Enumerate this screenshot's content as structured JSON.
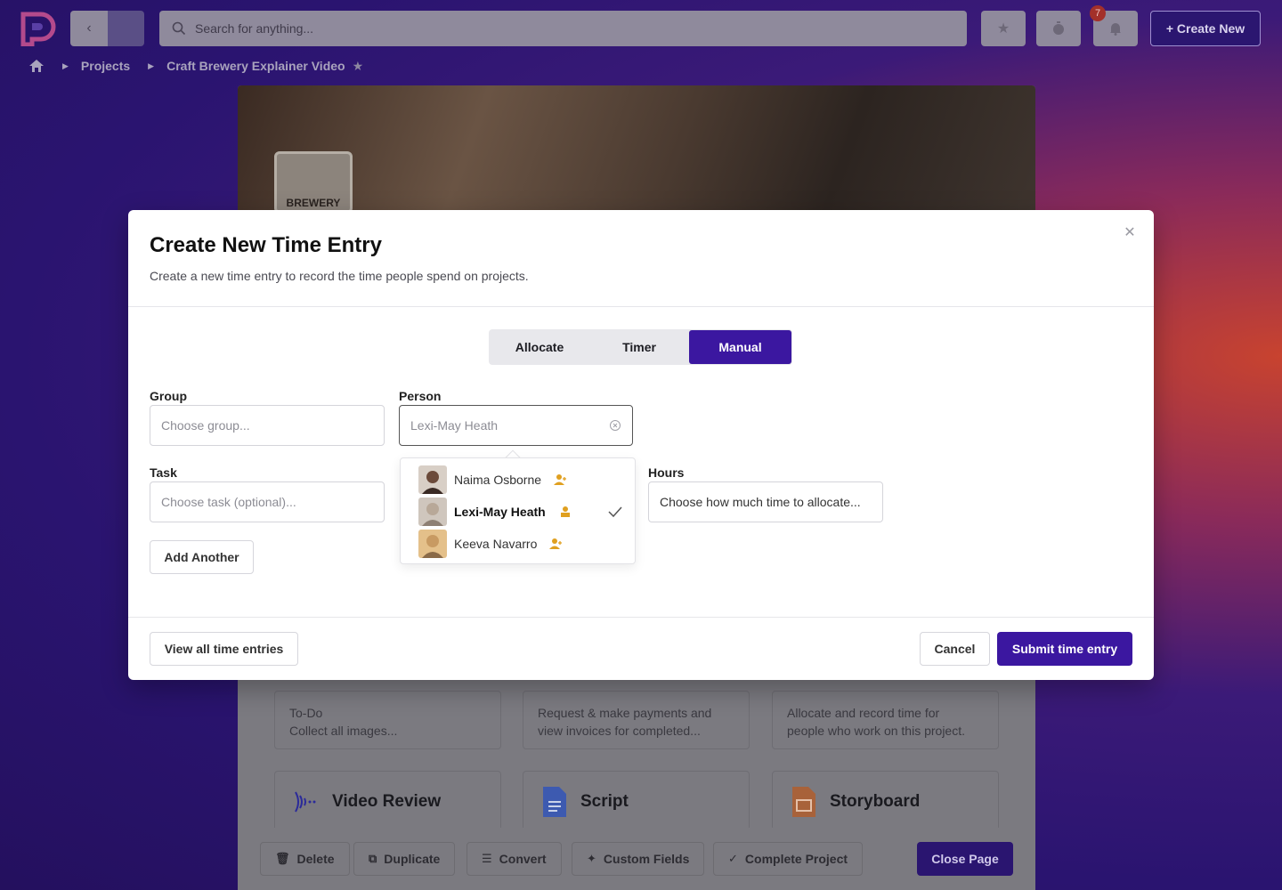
{
  "topbar": {
    "search_placeholder": "Search for anything...",
    "notification_count": "7",
    "create_new_label": "+ Create New"
  },
  "breadcrumb": {
    "projects": "Projects",
    "current": "Craft Brewery Explainer Video"
  },
  "background": {
    "hero_logo_text": "BREWERY",
    "tiles": [
      {
        "line1": "To-Do",
        "line2": "Collect all images..."
      },
      {
        "line1": "Request & make payments and",
        "line2": "view invoices for completed..."
      },
      {
        "line1": "Allocate and record time for",
        "line2": "people who work on this project."
      }
    ],
    "apps": [
      {
        "label": "Video Review",
        "icon": "waveform-icon"
      },
      {
        "label": "Script",
        "icon": "document-icon"
      },
      {
        "label": "Storyboard",
        "icon": "slides-icon"
      }
    ],
    "bottom_actions": {
      "delete": "Delete",
      "duplicate": "Duplicate",
      "convert": "Convert",
      "custom_fields": "Custom Fields",
      "complete_project": "Complete Project",
      "close_page": "Close Page"
    }
  },
  "modal": {
    "title": "Create New Time Entry",
    "subtitle": "Create a new time entry to record the time people spend on projects.",
    "tabs": [
      {
        "label": "Allocate",
        "active": false
      },
      {
        "label": "Timer",
        "active": false
      },
      {
        "label": "Manual",
        "active": true
      }
    ],
    "group": {
      "label": "Group",
      "placeholder": "Choose group..."
    },
    "person": {
      "label": "Person",
      "value": "Lexi-May Heath"
    },
    "task": {
      "label": "Task",
      "placeholder": "Choose task (optional)..."
    },
    "hours": {
      "label": "Hours",
      "placeholder": "Choose how much time to allocate..."
    },
    "add_another": "Add Another",
    "view_all": "View all time entries",
    "cancel": "Cancel",
    "submit": "Submit time entry",
    "people": [
      {
        "name": "Naima Osborne",
        "selected": false,
        "avatar_color": "#6b4a3a"
      },
      {
        "name": "Lexi-May Heath",
        "selected": true,
        "avatar_color": "#b8a898"
      },
      {
        "name": "Keeva Navarro",
        "selected": false,
        "avatar_color": "#c89a62"
      }
    ]
  },
  "colors": {
    "accent": "#3b17a0",
    "person_icon": "#e0a020"
  }
}
